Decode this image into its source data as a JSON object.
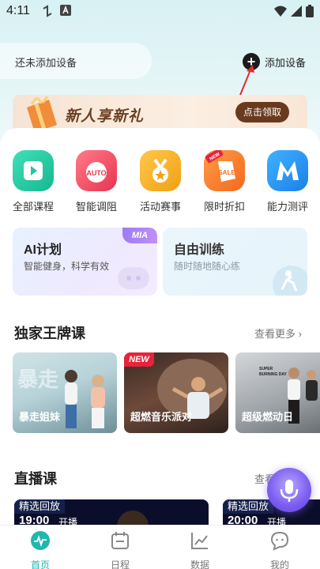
{
  "status_bar": {
    "time": "4:11"
  },
  "device": {
    "status": "还未添加设备",
    "add_label": "添加设备"
  },
  "banner": {
    "title": "新人享新礼",
    "button": "点击领取"
  },
  "categories": [
    {
      "label": "全部课程",
      "icon": "play-icon",
      "color": "#1fc8a0"
    },
    {
      "label": "智能调阻",
      "icon": "auto-icon",
      "color": "#f0506a"
    },
    {
      "label": "活动赛事",
      "icon": "medal-icon",
      "color": "#f4a41c"
    },
    {
      "label": "限时折扣",
      "icon": "sale-icon",
      "color": "#f7782a"
    },
    {
      "label": "能力测评",
      "icon": "m-logo-icon",
      "color": "#2d8ff0"
    }
  ],
  "plan_card": {
    "title": "AI计划",
    "subtitle": "智能健身，科学有效",
    "badge": "MIA"
  },
  "free_card": {
    "title": "自由训练",
    "subtitle": "随时随地随心练"
  },
  "exclusive": {
    "title": "独家王牌课",
    "more": "查看更多",
    "courses": [
      {
        "label": "暴走姐妹",
        "badge": "",
        "overlay": "暴走"
      },
      {
        "label": "超燃音乐派对",
        "badge": "NEW",
        "overlay": ""
      },
      {
        "label": "超级燃动日",
        "badge": "",
        "overlay": "SUPER BURNING DAY"
      }
    ]
  },
  "live": {
    "title": "直播课",
    "more": "查看",
    "items": [
      {
        "tag": "精选回放",
        "time": "19:00",
        "begin": "开播"
      },
      {
        "tag": "精选回放",
        "time": "20:00",
        "begin": "开播"
      }
    ]
  },
  "nav": [
    {
      "label": "首页",
      "icon": "heartbeat-icon",
      "active": true
    },
    {
      "label": "日程",
      "icon": "calendar-icon",
      "active": false
    },
    {
      "label": "数据",
      "icon": "chart-icon",
      "active": false
    },
    {
      "label": "我的",
      "icon": "chat-face-icon",
      "active": false
    }
  ],
  "colors": {
    "accent": "#1fb7b0",
    "banner_button": "#6a3a1f",
    "new_badge": "#e6243b"
  }
}
